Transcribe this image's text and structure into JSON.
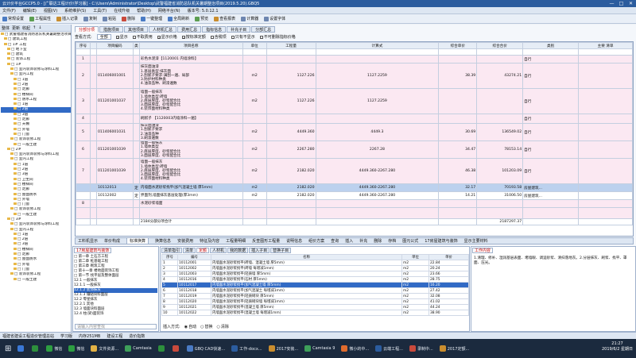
{
  "window": {
    "title": "云计价平台GCCP5.0 - [广联达工程计价\\学习版] - C:\\Users\\Administrator\\Desktop\\武警福建省消防总队机关暑期整治项目(2019.5.20).GBQ5",
    "min": "—",
    "max": "□",
    "close": "✕"
  },
  "menu": [
    "文件(F)",
    "编辑(E)",
    "视图(V)",
    "系统维护(S)",
    "工具(T)",
    "在线升级",
    "帮助(H)",
    "网络平台(N)",
    "版本号: 5.0.12.1"
  ],
  "toolbar": [
    {
      "label": "常规设置",
      "color": "#4a7bc4"
    },
    {
      "label": "工程属性",
      "color": "#5c9e52"
    },
    {
      "label": "插入记录",
      "color": "#c98d2e"
    },
    {
      "label": "复制",
      "color": "#6e86b0"
    },
    {
      "label": "粘贴",
      "color": "#6e86b0"
    },
    {
      "label": "删除",
      "color": "#c94a3c"
    },
    {
      "label": "一键整理",
      "color": "#4a7bc4"
    },
    {
      "label": "全局刷新",
      "color": "#4a7bc4"
    },
    {
      "label": "预览",
      "color": "#5c9e52"
    },
    {
      "label": "查看报表",
      "color": "#c98d2e"
    },
    {
      "label": "计算器",
      "color": "#6e86b0"
    },
    {
      "label": "设置字体",
      "color": "#6e86b0"
    }
  ],
  "left": {
    "header": [
      "整体",
      "更新",
      "收起",
      "↑",
      "↓"
    ],
    "tree": [
      {
        "label": "□ 武警福建省消防总队机关暑期整治项目",
        "indent": 0
      },
      {
        "label": "□ 建筑工程",
        "indent": 1
      },
      {
        "label": "□ 1# 工程",
        "indent": 1
      },
      {
        "label": "□ 地下室",
        "indent": 2
      },
      {
        "label": "□ 建筑",
        "indent": 2
      },
      {
        "label": "□ 装饰工程",
        "indent": 2
      },
      {
        "label": "□ 1#",
        "indent": 2
      },
      {
        "label": "□ 室内装饰装修与涂料工程",
        "indent": 3
      },
      {
        "label": "□ 室内工程",
        "indent": 3
      },
      {
        "label": "□ 1层",
        "indent": 4
      },
      {
        "label": "□ 2层",
        "indent": 4
      },
      {
        "label": "□ 走廊",
        "indent": 4
      },
      {
        "label": "□ 楼梯间",
        "indent": 4
      },
      {
        "label": "□ 防水工程",
        "indent": 4
      },
      {
        "label": "□ 1层",
        "indent": 4
      },
      {
        "label": "□ 2层",
        "indent": 4,
        "selected": true
      },
      {
        "label": "□ 3层",
        "indent": 4
      },
      {
        "label": "□ 走廊",
        "indent": 4
      },
      {
        "label": "□ 天棚",
        "indent": 4
      },
      {
        "label": "□ 外墙",
        "indent": 4
      },
      {
        "label": "□ 门窗",
        "indent": 4
      },
      {
        "label": "□ 装饰装修工程",
        "indent": 3
      },
      {
        "label": "□ 一般土建",
        "indent": 4
      },
      {
        "label": "□ 2#",
        "indent": 2
      },
      {
        "label": "□ 室内装饰装修与涂料工程",
        "indent": 3
      },
      {
        "label": "□ 室内工程",
        "indent": 3
      },
      {
        "label": "□ 1层",
        "indent": 4
      },
      {
        "label": "□ 2层",
        "indent": 4
      },
      {
        "label": "□ 3层",
        "indent": 4
      },
      {
        "label": "□ 卫生间",
        "indent": 4
      },
      {
        "label": "□ 楼梯间",
        "indent": 4
      },
      {
        "label": "□ 走廊",
        "indent": 4
      },
      {
        "label": "□ 屋面防水",
        "indent": 4
      },
      {
        "label": "□ 外墙",
        "indent": 4
      },
      {
        "label": "□ 门窗",
        "indent": 4
      },
      {
        "label": "□ 装饰装修工程",
        "indent": 3
      },
      {
        "label": "□ 一般土建",
        "indent": 4
      },
      {
        "label": "□ 3#",
        "indent": 2
      },
      {
        "label": "□ 室内装饰装修与涂料工程",
        "indent": 3
      },
      {
        "label": "□ 室内工程",
        "indent": 3
      },
      {
        "label": "□ 1层",
        "indent": 4
      },
      {
        "label": "□ 2层",
        "indent": 4
      },
      {
        "label": "□ 3层",
        "indent": 4
      },
      {
        "label": "□ 楼梯间",
        "indent": 4
      },
      {
        "label": "□ 走廊",
        "indent": 4
      },
      {
        "label": "□ 屋面防水",
        "indent": 4
      },
      {
        "label": "□ 外墙",
        "indent": 4
      },
      {
        "label": "□ 门窗",
        "indent": 4
      },
      {
        "label": "□ 装饰装修工程",
        "indent": 3
      },
      {
        "label": "□ 一般土建",
        "indent": 4
      }
    ]
  },
  "tabs": [
    "分部分项",
    "措施项目",
    "其他项目",
    "人材机汇总",
    "费用汇总",
    "指标信息",
    "补充子目",
    "分部汇总"
  ],
  "active_tab": "分部分项",
  "filter": {
    "label": "查看方式:",
    "select": "全部",
    "checks": [
      {
        "label": "显示",
        "checked": true
      },
      {
        "label": "不取费用",
        "checked": false
      },
      {
        "label": "显示价格",
        "checked": true
      },
      {
        "label": "按标准定额",
        "checked": true
      },
      {
        "label": "含税项",
        "checked": false
      },
      {
        "label": "只有不显示",
        "checked": false
      },
      {
        "label": "不可删除指标价格",
        "checked": false
      }
    ]
  },
  "table": {
    "headers": [
      "序号",
      "",
      "项目编码",
      "类",
      "项目名称",
      "单位",
      "工程量",
      "计算式",
      "综合单价",
      "综合合价",
      "类别",
      "主要\n清单"
    ],
    "amount_header": "工程量",
    "rows": [
      {
        "seq": "",
        "code": "",
        "type": "",
        "name": "",
        "unit": "",
        "qty": "",
        "expr": "",
        "price": "",
        "total": "",
        "cat": "",
        "style": "row-white",
        "h": 8
      },
      {
        "seq": "1",
        "code": "",
        "type": "",
        "name": "彩色水泥漆【1120001 内墙涂料】",
        "unit": "",
        "qty": "",
        "expr": "",
        "price": "",
        "total": "",
        "cat": "自行",
        "style": "row-pink",
        "h": 10
      },
      {
        "seq": "2",
        "code": "011406001001",
        "type": "",
        "name": "抹灰面油漆\n1.基层类型:抹灰面\n2.刮腻子要求:满刮一遍、局部\n3.防护材料种类\n4.油漆品种、刷漆遍数",
        "unit": "m2",
        "qty": "1127.226",
        "expr": "1127.2259",
        "price": "38.39",
        "total": "43274.21",
        "cat": "自行",
        "style": "row-pink",
        "h": 32
      },
      {
        "seq": "3",
        "code": "011201001037",
        "type": "",
        "name": "墙面一般抹灰\n1.墙体类型:砖墙\n2.底层厚度、砂浆配合比\n3.面层厚度、砂浆配合比\n4.装饰面材料种类",
        "unit": "m2",
        "qty": "1127.226",
        "expr": "1127.2259",
        "price": "",
        "total": "",
        "cat": "自行",
        "style": "row-pink",
        "h": 32
      },
      {
        "seq": "4",
        "code": "",
        "type": "",
        "name": "刷腻子 【1120003内墙涂料一遍】",
        "unit": "",
        "qty": "",
        "expr": "",
        "price": "",
        "total": "",
        "cat": "自行",
        "style": "row-pink",
        "h": 12
      },
      {
        "seq": "5",
        "code": "011406001031",
        "type": "",
        "name": "抹灰面油漆\n1.刮腻子要求\n2.油漆品种\n3.刷漆遍数",
        "unit": "m2",
        "qty": "4449.360",
        "expr": "4449.3",
        "price": "30.69",
        "total": "136549.02",
        "cat": "自行",
        "style": "row-pink",
        "h": 22
      },
      {
        "seq": "6",
        "code": "011201001039",
        "type": "",
        "name": "墙面一般抹灰\n1.墙体类型\n2.底层厚度、砂浆配合比\n3.面层厚度、砂浆配合比",
        "unit": "m2",
        "qty": "2267.280",
        "expr": "2267.28",
        "price": "34.47",
        "total": "78153.14",
        "cat": "自行",
        "style": "row-pink",
        "h": 22
      },
      {
        "seq": "7",
        "code": "011201001039",
        "type": "",
        "name": "墙面一般抹灰\n1.墙体类型:砖墙\n2.底层厚度、砂浆配合比\n3.面层厚度、砂浆配合比\n4.装饰面材料种类",
        "unit": "m2",
        "qty": "2182.020",
        "expr": "4449.360-2267.280",
        "price": "46.38",
        "total": "101203.09",
        "cat": "自行",
        "style": "row-pink",
        "h": 32
      },
      {
        "seq": "",
        "code": "10112013",
        "type": "定",
        "name": "内墙面水泥砂浆找平(加气混凝土墙 厚5mm)",
        "unit": "m2",
        "qty": "2182.020",
        "expr": "4449.360-2267.280",
        "price": "32.17",
        "total": "70193.58",
        "cat": "房屋建筑...",
        "style": "row-sel",
        "h": 10
      },
      {
        "seq": "",
        "code": "10112002",
        "type": "定",
        "name": "界面剂,墙面抹灰基层处理(厚3mm)",
        "unit": "m2",
        "qty": "2182.020",
        "expr": "4449.360-2267.280",
        "price": "14.21",
        "total": "31006.50",
        "cat": "房屋建筑...",
        "style": "row-white",
        "h": 10
      },
      {
        "seq": "8",
        "code": "",
        "type": "",
        "name": "水泥砂浆墙面",
        "unit": "",
        "qty": "",
        "expr": "",
        "price": "",
        "total": "",
        "cat": "",
        "style": "row-pink",
        "h": 10
      },
      {
        "seq": "",
        "code": "",
        "type": "",
        "name": "",
        "unit": "",
        "qty": "",
        "expr": "",
        "price": "",
        "total": "",
        "cat": "",
        "style": "row-pink",
        "h": 14
      },
      {
        "seq": "",
        "code": "",
        "type": "",
        "name": "2184分部分项合计",
        "unit": "",
        "qty": "",
        "expr": "",
        "price": "",
        "total": "2187297.37",
        "cat": "",
        "style": "row-white",
        "h": 8
      }
    ]
  },
  "bottom_tabs": [
    "工料机显示",
    "单价构成",
    "标准换算",
    "换算信息",
    "安装费用",
    "特征及内容",
    "工程量明细",
    "反查图形工程量",
    "说明信息",
    "组价方案",
    "查询",
    "插入",
    "补充",
    "删除",
    "存档",
    "图元公式",
    "17房屋建筑与装饰",
    "显示主要材料"
  ],
  "active_bottom": "标准换算",
  "lower_left": {
    "header": "17房屋建筑与装饰",
    "tree": [
      {
        "label": "□ 第一章 土石方工程",
        "sel": false
      },
      {
        "label": "□ 第二章 桩基础工程",
        "sel": false
      },
      {
        "label": "□ 第三章 砌筑工程",
        "sel": false
      },
      {
        "label": "□ 第十一章 楼地面装饰工程",
        "sel": false
      },
      {
        "label": "  □ 第一节 找平层及整体面层",
        "sel": false
      },
      {
        "label": "    12.1 一般抹灰",
        "sel": false
      },
      {
        "label": "    12.1.1 一般抹灰",
        "sel": false
      },
      {
        "label": "    12.1.2 装饰抹灰",
        "sel": true
      },
      {
        "label": "    12.1.3 镶贴块料面层",
        "sel": false
      },
      {
        "label": "    12.2 零星抹灰",
        "sel": false
      },
      {
        "label": "    12.2.1 其他",
        "sel": false
      },
      {
        "label": "    12.3 墙面块料面层",
        "sel": false
      },
      {
        "label": "    12.4 柱(梁)面装饰",
        "sel": false
      }
    ],
    "footer": "请输入内容查找"
  },
  "lower_mid": {
    "subtabs": [
      "清单指引",
      "清单",
      "定额",
      "人材机",
      "我的数据",
      "插入子目",
      "替换子目"
    ],
    "active_sub": "定额",
    "cols": [
      "序号",
      "编号",
      "名称",
      "单位",
      "单价"
    ],
    "rows": [
      {
        "n": "1",
        "c": "10112001",
        "name": "内墙面水泥砂浆找平(砖墙、混凝土墙 厚5mm)",
        "u": "m2",
        "p": "22.84"
      },
      {
        "n": "2",
        "c": "10112002",
        "name": "内墙面水泥砂浆找平(砖墙 每增减1mm)",
        "u": "m2",
        "p": "20.24"
      },
      {
        "n": "3",
        "c": "10112003",
        "name": "内墙面水泥砂浆找平(轻质墙 厚5mm)",
        "u": "m2",
        "p": "23.66"
      },
      {
        "n": "4",
        "c": "10112016",
        "name": "内墙面水泥砂浆找平(石材 厚5mm)",
        "u": "m2",
        "p": "28.75"
      },
      {
        "n": "5",
        "c": "10112017",
        "name": "内墙面水泥砂浆找平(加气混凝土墙 厚5mm)",
        "u": "m2",
        "p": "16.20",
        "hl": true
      },
      {
        "n": "6",
        "c": "10112018",
        "name": "内墙面水泥砂浆找平(加气混凝土 每增减1mm)",
        "u": "m2",
        "p": "27.42"
      },
      {
        "n": "7",
        "c": "10112019",
        "name": "内墙面水泥砂浆找平(轻质砌块 厚5mm)",
        "u": "m2",
        "p": "32.08"
      },
      {
        "n": "8",
        "c": "10112020",
        "name": "内墙面水泥砂浆找平(轻质砌块墙 每增减1mm)",
        "u": "m2",
        "p": "41.02"
      },
      {
        "n": "9",
        "c": "10112021",
        "name": "内墙面水泥砂浆找平(混凝土墙 厚5mm)",
        "u": "m2",
        "p": "44.24"
      },
      {
        "n": "10",
        "c": "10112022",
        "name": "内墙面水泥砂浆找平(混凝土墙 每增减1mm)",
        "u": "m2",
        "p": "38.90"
      }
    ],
    "footer_label": "插入方式:",
    "opts": [
      "自动",
      "替换",
      "清除"
    ]
  },
  "lower_right": {
    "title": "工作内容",
    "text": "1.清理、修补、湿润基层表面、堵墙眼、调运砂浆、清扫落地灰。2.分层抹灰、刷浆、找平、罩面、压光。"
  },
  "status": [
    "福建省建设工程造价管理总站",
    "学习版",
    "内存251MB",
    "建设工程",
    "造价指数"
  ],
  "taskbar": [
    {
      "label": "",
      "color": "#3a78d6"
    },
    {
      "label": "",
      "color": "#2d8f3c"
    },
    {
      "label": "微信",
      "color": "#2d9e41"
    },
    {
      "label": "微信",
      "color": "#2d9e41"
    },
    {
      "label": "文件资源...",
      "color": "#e3b245"
    },
    {
      "label": "Camtasia",
      "color": "#3ea05a"
    },
    {
      "label": "",
      "color": "#2d8f3c"
    },
    {
      "label": "",
      "color": "#c94a3c"
    },
    {
      "label": "GBQ CAD快速...",
      "color": "#4a7bc4"
    },
    {
      "label": "工作-docx...",
      "color": "#2b5c9e"
    },
    {
      "label": "2017安装...",
      "color": "#c98d2e"
    },
    {
      "label": "Camtasia 9",
      "color": "#3ea05a"
    },
    {
      "label": "微小的中...",
      "color": "#e06b2d"
    },
    {
      "label": "云端工程...",
      "color": "#2b5c9e"
    },
    {
      "label": "录制中...",
      "color": "#c94a3c"
    },
    {
      "label": "2017定额...",
      "color": "#c98d2e"
    }
  ],
  "clock": {
    "time": "21:27",
    "date": "2019/6/2 星期日"
  }
}
